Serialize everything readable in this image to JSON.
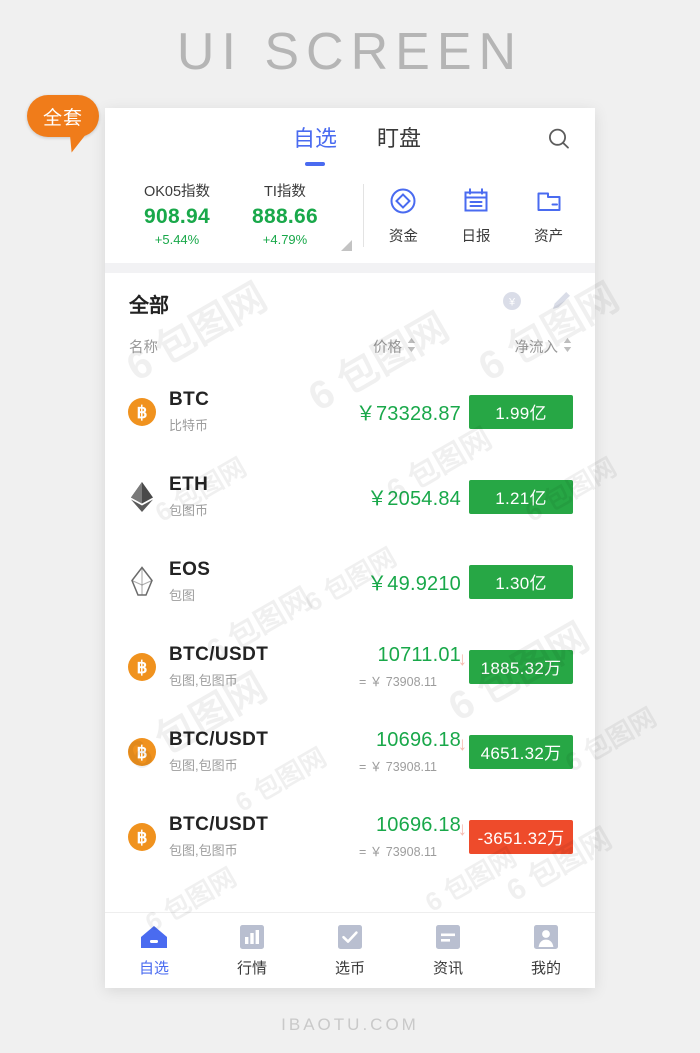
{
  "page": {
    "title": "UI SCREEN",
    "footer": "IBAOTU.COM",
    "badge": "全套",
    "watermark": "6 包图网"
  },
  "colors": {
    "accent": "#4a6bf0",
    "up_green": "#19a84a",
    "badge_green": "#27a745",
    "badge_red": "#ee4b2b",
    "orange": "#f07c1a",
    "muted": "#9a9a9a"
  },
  "header": {
    "tabs": [
      {
        "label": "自选",
        "active": true
      },
      {
        "label": "盯盘",
        "active": false
      }
    ],
    "search_icon": "search-icon"
  },
  "indices": [
    {
      "name": "OK05指数",
      "value": "908.94",
      "change": "+5.44%"
    },
    {
      "name": "TI指数",
      "value": "888.66",
      "change": "+4.79%"
    }
  ],
  "quick_actions": [
    {
      "label": "资金",
      "icon": "coin-circle-icon"
    },
    {
      "label": "日报",
      "icon": "calendar-report-icon"
    },
    {
      "label": "资产",
      "icon": "wallet-folder-icon"
    }
  ],
  "list": {
    "filter_title": "全部",
    "filter_icons": [
      {
        "name": "yen-currency-icon"
      },
      {
        "name": "edit-pencil-icon"
      }
    ],
    "columns": {
      "name": "名称",
      "price": "价格",
      "flow": "净流入"
    },
    "rows": [
      {
        "icon": "bitcoin-icon",
        "symbol": "BTC",
        "sub": "比特币",
        "price": "￥73328.87",
        "price_sub": "",
        "arrow": false,
        "flow": "1.99亿",
        "flow_positive": true
      },
      {
        "icon": "ethereum-icon",
        "symbol": "ETH",
        "sub": "包图币",
        "price": "￥2054.84",
        "price_sub": "",
        "arrow": false,
        "flow": "1.21亿",
        "flow_positive": true
      },
      {
        "icon": "eos-icon",
        "symbol": "EOS",
        "sub": "包图",
        "price": "￥49.9210",
        "price_sub": "",
        "arrow": false,
        "flow": "1.30亿",
        "flow_positive": true
      },
      {
        "icon": "bitcoin-icon",
        "symbol": "BTC/USDT",
        "sub": "包图,包图币",
        "price": "10711.01",
        "price_sub": "= ￥ 73908.11",
        "arrow": true,
        "flow": "1885.32万",
        "flow_positive": true
      },
      {
        "icon": "bitcoin-icon",
        "symbol": "BTC/USDT",
        "sub": "包图,包图币",
        "price": "10696.18",
        "price_sub": "= ￥ 73908.11",
        "arrow": true,
        "flow": "4651.32万",
        "flow_positive": true
      },
      {
        "icon": "bitcoin-icon",
        "symbol": "BTC/USDT",
        "sub": "包图,包图币",
        "price": "10696.18",
        "price_sub": "= ￥ 73908.11",
        "arrow": true,
        "flow": "-3651.32万",
        "flow_positive": false
      }
    ]
  },
  "bottom_nav": [
    {
      "label": "自选",
      "icon": "home-icon",
      "active": true
    },
    {
      "label": "行情",
      "icon": "bar-chart-icon",
      "active": false
    },
    {
      "label": "选币",
      "icon": "check-icon",
      "active": false
    },
    {
      "label": "资讯",
      "icon": "news-icon",
      "active": false
    },
    {
      "label": "我的",
      "icon": "person-icon",
      "active": false
    }
  ]
}
